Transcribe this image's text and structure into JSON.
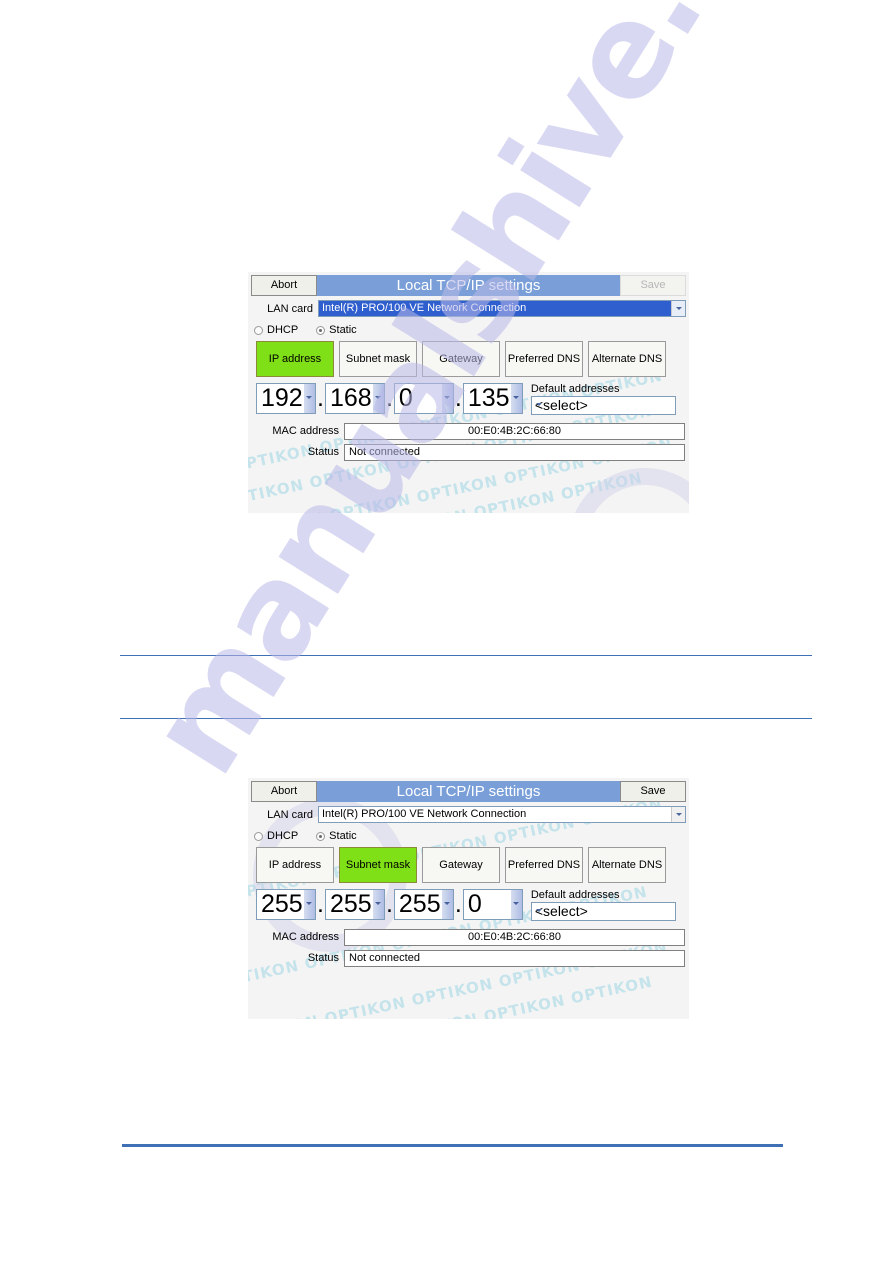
{
  "page": {
    "watermark_text": "manualshive.com",
    "panel_watermark_text": "OPTIKON",
    "rule_color": "#3f6fb5"
  },
  "colors": {
    "title_bar": "#7a9fd8",
    "active_tab_green": "#80e017",
    "combo_selected_blue": "#2f5fce",
    "rule_blue": "#3f6fb5"
  },
  "panels": [
    {
      "titlebar": {
        "abort_label": "Abort",
        "title": "Local TCP/IP settings",
        "save_label": "Save",
        "save_enabled": false
      },
      "lan_card": {
        "label": "LAN card",
        "value": "Intel(R) PRO/100 VE Network Connection",
        "highlighted": true
      },
      "mode": {
        "dhcp_label": "DHCP",
        "dhcp_selected": false,
        "static_label": "Static",
        "static_selected": true
      },
      "tabs": [
        {
          "label": "IP address",
          "active": true
        },
        {
          "label": "Subnet mask",
          "active": false
        },
        {
          "label": "Gateway",
          "active": false
        },
        {
          "label": "Preferred DNS",
          "active": false
        },
        {
          "label": "Alternate DNS",
          "active": false
        }
      ],
      "octets": [
        "192",
        "168",
        "0",
        "135"
      ],
      "default_addresses": {
        "label": "Default addresses",
        "value": "<select>"
      },
      "mac": {
        "label": "MAC address",
        "value": "00:E0:4B:2C:66:80"
      },
      "status": {
        "label": "Status",
        "value": "Not connected"
      }
    },
    {
      "titlebar": {
        "abort_label": "Abort",
        "title": "Local TCP/IP settings",
        "save_label": "Save",
        "save_enabled": true
      },
      "lan_card": {
        "label": "LAN card",
        "value": "Intel(R) PRO/100 VE Network Connection",
        "highlighted": false
      },
      "mode": {
        "dhcp_label": "DHCP",
        "dhcp_selected": false,
        "static_label": "Static",
        "static_selected": true
      },
      "tabs": [
        {
          "label": "IP address",
          "active": false
        },
        {
          "label": "Subnet mask",
          "active": true
        },
        {
          "label": "Gateway",
          "active": false
        },
        {
          "label": "Preferred DNS",
          "active": false
        },
        {
          "label": "Alternate DNS",
          "active": false
        }
      ],
      "octets": [
        "255",
        "255",
        "255",
        "0"
      ],
      "default_addresses": {
        "label": "Default addresses",
        "value": "<select>"
      },
      "mac": {
        "label": "MAC address",
        "value": "00:E0:4B:2C:66:80"
      },
      "status": {
        "label": "Status",
        "value": "Not connected"
      }
    }
  ]
}
